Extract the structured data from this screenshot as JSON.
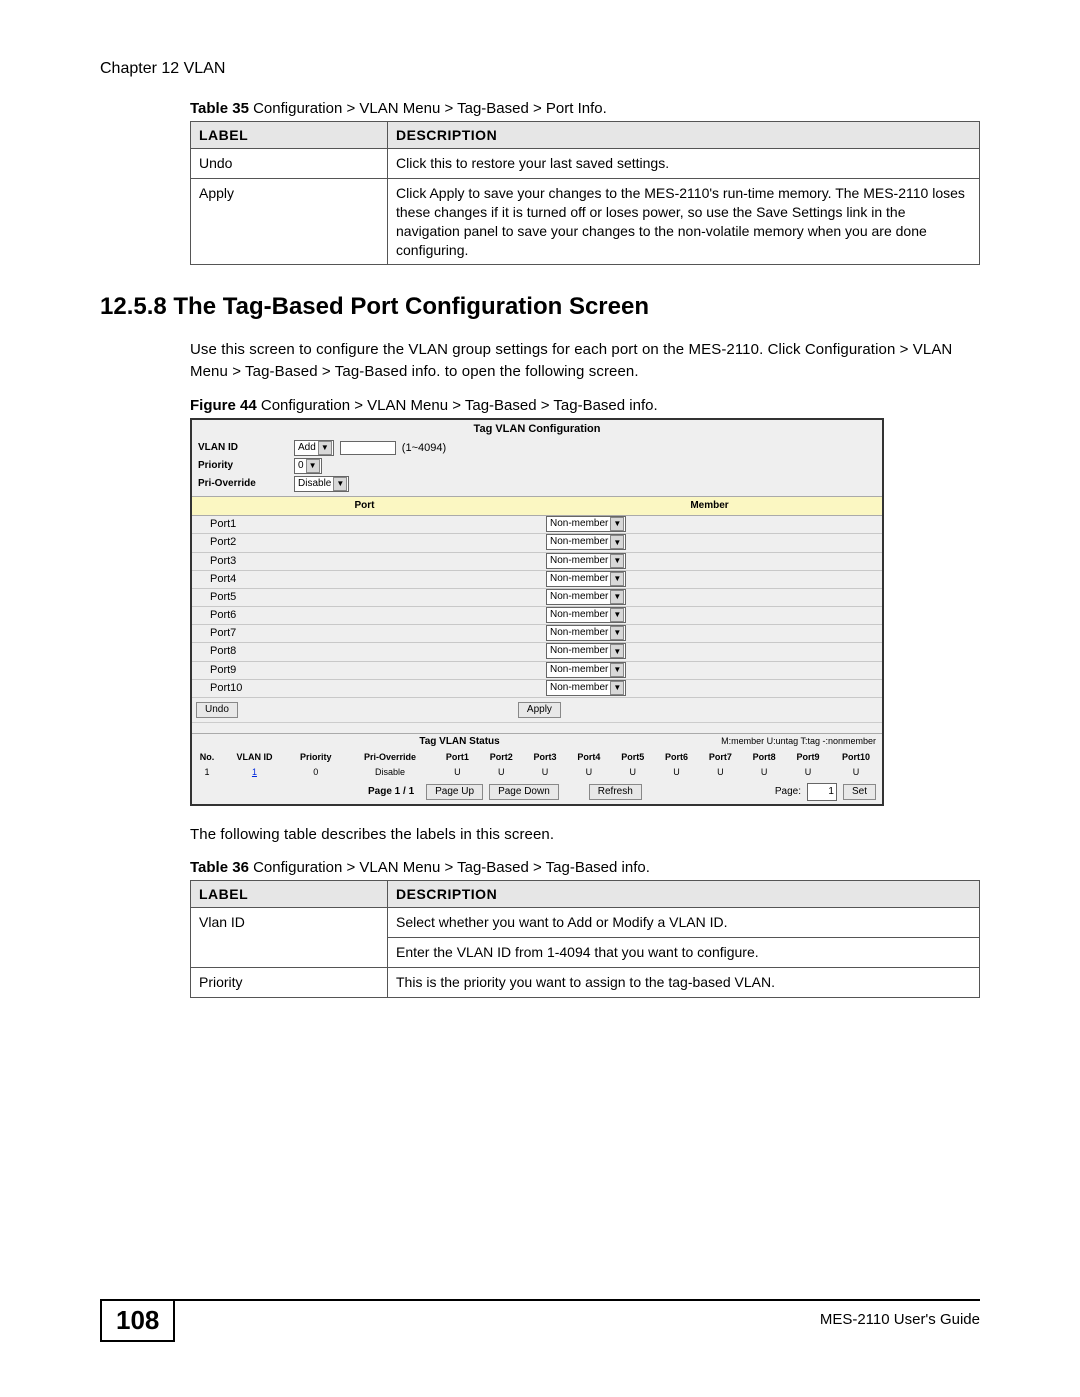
{
  "header": {
    "chapter": "Chapter 12 VLAN"
  },
  "footer": {
    "page_number": "108",
    "guide": "MES-2110 User's Guide"
  },
  "table35": {
    "caption_bold": "Table 35",
    "caption_rest": "   Configuration > VLAN Menu > Tag-Based > Port Info.",
    "col1": "LABEL",
    "col2": "DESCRIPTION",
    "rows": [
      {
        "label": "Undo",
        "desc": "Click this to restore your last saved settings."
      },
      {
        "label": "Apply",
        "desc": "Click Apply to save your changes to the MES-2110's run-time memory. The MES-2110 loses these changes if it is turned off or loses power, so use the Save Settings link in the navigation panel to save your changes to the non-volatile memory when you are done configuring."
      }
    ]
  },
  "section": {
    "number_title": "12.5.8  The Tag-Based Port Configuration Screen",
    "para1": "Use this screen to configure the VLAN group settings for each port on the MES-2110. Click Configuration > VLAN Menu > Tag-Based > Tag-Based info. to open the following screen."
  },
  "figure44": {
    "caption_bold": "Figure 44",
    "caption_rest": "   Configuration > VLAN Menu > Tag-Based > Tag-Based info."
  },
  "screenshot": {
    "title": "Tag VLAN Configuration",
    "vlan_id_label": "VLAN ID",
    "vlan_id_select": "Add",
    "vlan_id_hint": "(1~4094)",
    "priority_label": "Priority",
    "priority_value": "0",
    "prioverride_label": "Pri-Override",
    "prioverride_value": "Disable",
    "col_port": "Port",
    "col_member": "Member",
    "member_value": "Non-member",
    "ports": [
      "Port1",
      "Port2",
      "Port3",
      "Port4",
      "Port5",
      "Port6",
      "Port7",
      "Port8",
      "Port9",
      "Port10"
    ],
    "btn_undo": "Undo",
    "btn_apply": "Apply",
    "status_title": "Tag VLAN Status",
    "status_legend": "M:member  U:untag  T:tag  -:nonmember",
    "status_cols": [
      "No.",
      "VLAN ID",
      "Priority",
      "Pri-Override",
      "Port1",
      "Port2",
      "Port3",
      "Port4",
      "Port5",
      "Port6",
      "Port7",
      "Port8",
      "Port9",
      "Port10"
    ],
    "status_row": [
      "1",
      "1",
      "0",
      "Disable",
      "U",
      "U",
      "U",
      "U",
      "U",
      "U",
      "U",
      "U",
      "U",
      "U"
    ],
    "pager_label": "Page 1 / 1",
    "pager_up": "Page Up",
    "pager_down": "Page Down",
    "pager_refresh": "Refresh",
    "pager_page_lbl": "Page:",
    "pager_page_val": "1",
    "pager_set": "Set"
  },
  "after_figure_text": "The following table describes the labels in this screen.",
  "table36": {
    "caption_bold": "Table 36",
    "caption_rest": "   Configuration > VLAN Menu > Tag-Based > Tag-Based info.",
    "col1": "LABEL",
    "col2": "DESCRIPTION",
    "rows": [
      {
        "label": "Vlan ID",
        "desc1": "Select whether you want to Add or Modify a VLAN ID.",
        "desc2": "Enter the VLAN ID from 1-4094 that you want to configure."
      },
      {
        "label": "Priority",
        "desc1": "This is the priority you want to assign to the tag-based VLAN."
      }
    ]
  }
}
